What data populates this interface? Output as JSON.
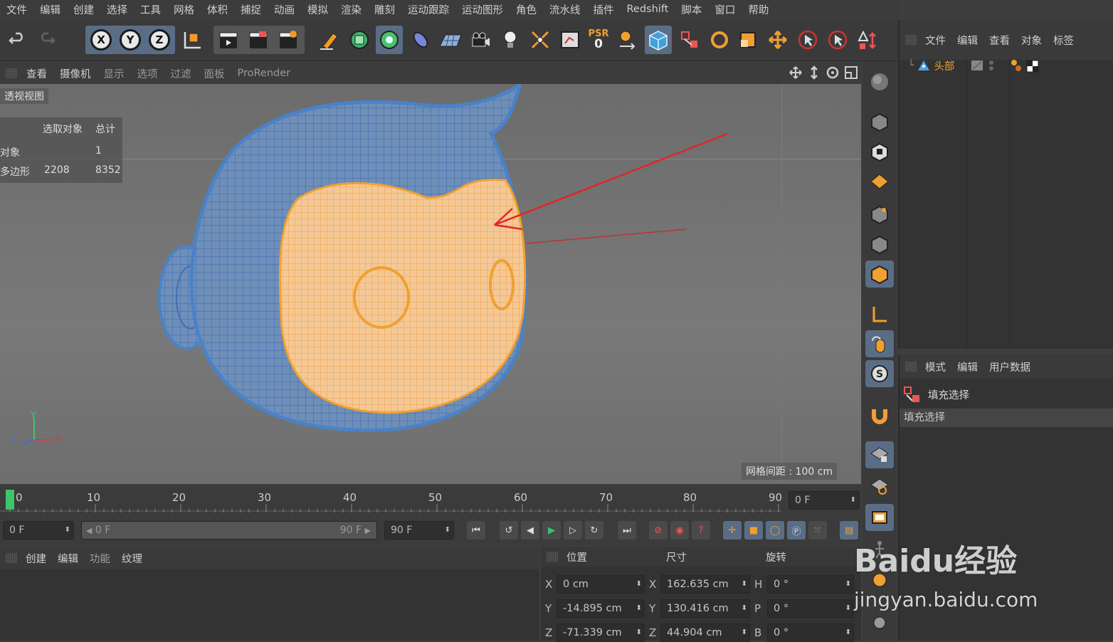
{
  "menu": [
    "文件",
    "编辑",
    "创建",
    "选择",
    "工具",
    "网格",
    "体积",
    "捕捉",
    "动画",
    "模拟",
    "渲染",
    "雕刻",
    "运动跟踪",
    "运动图形",
    "角色",
    "流水线",
    "插件",
    "Redshift",
    "脚本",
    "窗口",
    "帮助"
  ],
  "toolbar": {
    "x": "X",
    "y": "Y",
    "z": "Z",
    "psr_label": "PSR",
    "psr_value": "0"
  },
  "viewport_menu": [
    "查看",
    "摄像机",
    "显示",
    "选项",
    "过滤",
    "面板",
    "ProRender"
  ],
  "viewport": {
    "name": "透视视图",
    "grid_spacing": "网格间距 : 100 cm",
    "hud": {
      "col_selected": "选取对象",
      "col_total": "总计",
      "row1_label": "对象",
      "row1_total": "1",
      "row2_label": "多边形",
      "row2_selected": "2208",
      "row2_total": "8352"
    },
    "axis": {
      "x": "X",
      "y": "Y",
      "z": "Z"
    }
  },
  "object_manager": {
    "menu": [
      "文件",
      "编辑",
      "查看",
      "对象",
      "标签"
    ],
    "objects": [
      {
        "name": "头部"
      }
    ]
  },
  "attribute_manager": {
    "menu": [
      "模式",
      "编辑",
      "用户数据"
    ],
    "tool_name": "填充选择",
    "section": "填充选择"
  },
  "timeline": {
    "ticks": [
      "0",
      "10",
      "20",
      "30",
      "40",
      "50",
      "60",
      "70",
      "80",
      "90"
    ],
    "current_frame": "0 F"
  },
  "transport": {
    "start": "0 F",
    "range_start": "0 F",
    "range_end": "90 F",
    "end": "90 F"
  },
  "material_manager": {
    "menu": [
      "创建",
      "编辑",
      "功能",
      "纹理"
    ]
  },
  "coordinates": {
    "headers": [
      "位置",
      "尺寸",
      "旋转"
    ],
    "rows": [
      {
        "axis": "X",
        "pos": "0 cm",
        "size_axis": "X",
        "size": "162.635 cm",
        "rot_axis": "H",
        "rot": "0 °"
      },
      {
        "axis": "Y",
        "pos": "-14.895 cm",
        "size_axis": "Y",
        "size": "130.416 cm",
        "rot_axis": "P",
        "rot": "0 °"
      },
      {
        "axis": "Z",
        "pos": "-71.339 cm",
        "size_axis": "Z",
        "size": "44.904 cm",
        "rot_axis": "B",
        "rot": "0 °"
      }
    ]
  },
  "watermark": {
    "brand": "Baidu经验",
    "url": "jingyan.baidu.com"
  },
  "colors": {
    "accent": "#f0a030",
    "selection": "#f7a63a",
    "mesh_blue": "#4a82c8",
    "play_green": "#3ec46a"
  }
}
